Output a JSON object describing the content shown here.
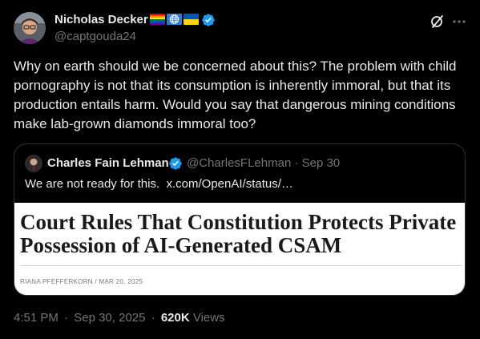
{
  "post": {
    "author": {
      "name": "Nicholas Decker",
      "handle": "@captgouda24",
      "flags": [
        "rainbow-flag",
        "globe-icon",
        "ukraine-flag"
      ],
      "verified_icon": "verified-badge-icon"
    },
    "actions": {
      "grok_icon": "grok-icon",
      "more_icon": "more-options-icon"
    },
    "text": "Why on earth should we be concerned about this? The problem with child pornography is not that its consumption is inherently immoral, but that its production entails harm. Would you say that dangerous mining conditions make lab-grown diamonds immoral too?",
    "quote": {
      "author_name": "Charles Fain Lehman",
      "handle": "@CharlesFLehman",
      "separator": "·",
      "time": "Sep 30",
      "text": "We are not ready for this.",
      "link": "x.com/OpenAI/status/…",
      "article": {
        "headline": "Court Rules That Constitution Protects Private Possession of AI-Generated CSAM",
        "byline": "RIANA PFEFFERKORN / MAR 20, 2025"
      }
    },
    "meta": {
      "time": "4:51 PM",
      "separator": "·",
      "date": "Sep 30, 2025",
      "views_count": "620K",
      "views_label": "Views"
    }
  },
  "colors": {
    "background": "#000000",
    "text_primary": "#e7e9ea",
    "text_secondary": "#71767b",
    "border": "#2f3336",
    "verified": "#1d9bf0"
  }
}
